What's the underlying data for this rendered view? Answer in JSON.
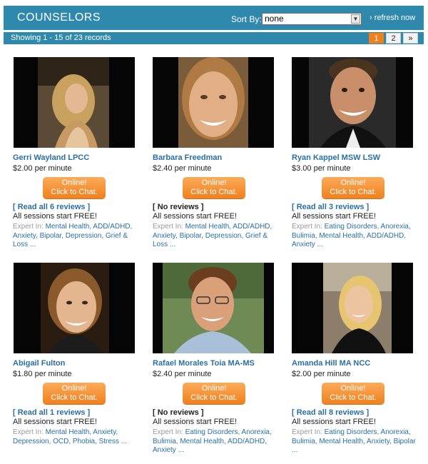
{
  "header": {
    "title": "COUNSELORS",
    "sort_label": "Sort By:",
    "sort_value": "none",
    "refresh": "› refresh now"
  },
  "subbar": {
    "showing": "Showing 1 - 15 of 23 records",
    "pages": [
      "1",
      "2",
      "»"
    ],
    "current_page": "1"
  },
  "counselors": [
    {
      "name": "Gerri Wayland LPCC",
      "price": "$2.00 per minute",
      "button_line1": "Online!",
      "button_line2": "Click to Chat.",
      "reviews": "[ Read all 6 reviews ]",
      "free": "All sessions start FREE!",
      "expert_label": "Expert In:",
      "expert_tags": "Mental Health, ADD/ADHD, Anxiety, Bipolar, Depression, Grief & Loss ..."
    },
    {
      "name": "Barbara Freedman",
      "price": "$2.40 per minute",
      "button_line1": "Online!",
      "button_line2": "Click to Chat.",
      "reviews": "[ No reviews ]",
      "free": "All sessions start FREE!",
      "expert_label": "Expert In:",
      "expert_tags": "Mental Health, ADD/ADHD, Anxiety, Bipolar, Depression, Grief & Loss ..."
    },
    {
      "name": "Ryan Kappel MSW LSW",
      "price": "$3.00 per minute",
      "button_line1": "Online!",
      "button_line2": "Click to Chat.",
      "reviews": "[ Read all 3 reviews ]",
      "free": "All sessions start FREE!",
      "expert_label": "Expert In:",
      "expert_tags": "Eating Disorders, Anorexia, Bulimia, Mental Health, ADD/ADHD, Anxiety ..."
    },
    {
      "name": "Abigail Fulton",
      "price": "$1.80 per minute",
      "button_line1": "Online!",
      "button_line2": "Click to Chat.",
      "reviews": "[ Read all 1 reviews ]",
      "free": "All sessions start FREE!",
      "expert_label": "Expert In:",
      "expert_tags": "Mental Health, Anxiety, Depression, OCD, Phobia, Stress ..."
    },
    {
      "name": "Rafael Morales Toia MA-MS",
      "price": "$2.40 per minute",
      "button_line1": "Online!",
      "button_line2": "Click to Chat.",
      "reviews": "[ No reviews ]",
      "free": "All sessions start FREE!",
      "expert_label": "Expert In:",
      "expert_tags": "Eating Disorders, Anorexia, Bulimia, Mental Health, ADD/ADHD, Anxiety ..."
    },
    {
      "name": "Amanda Hill MA NCC",
      "price": "$2.00 per minute",
      "button_line1": "Online!",
      "button_line2": "Click to Chat.",
      "reviews": "[ Read all 8 reviews ]",
      "free": "All sessions start FREE!",
      "expert_label": "Expert In:",
      "expert_tags": "Eating Disorders, Anorexia, Bulimia, Mental Health, Anxiety, Bipolar ..."
    }
  ],
  "colors": {
    "header_bg": "#2f89ad",
    "accent_orange": "#f07f1d",
    "link_blue": "#2a6fa5"
  }
}
